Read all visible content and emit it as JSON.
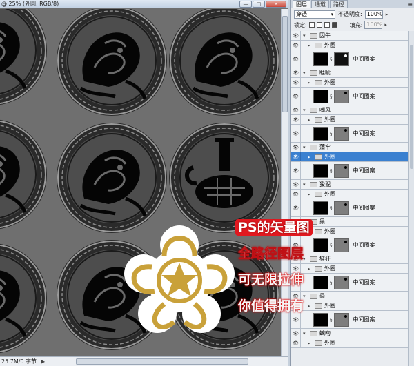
{
  "document": {
    "title": "@ 25% (外圆, RGB/8)",
    "window_buttons": [
      "—",
      "□",
      "✕"
    ],
    "status": "25.7M/0 字节",
    "status_arrow": "▶"
  },
  "layers_panel": {
    "tabs": [
      "图层",
      "通道",
      "路径"
    ],
    "active_tab": 0,
    "menu_icon": "≡",
    "blend_mode": "穿透",
    "opacity_label": "不透明度:",
    "opacity_value": "100%",
    "lock_label": "锁定:",
    "fill_label": "填充:",
    "fill_value": "100%",
    "layers": [
      {
        "kind": "group",
        "name": "囚牛",
        "indent": 0
      },
      {
        "kind": "group",
        "name": "外圈",
        "indent": 1
      },
      {
        "kind": "layer",
        "name": "中间图案",
        "mask": "dark"
      },
      {
        "kind": "group",
        "name": "睚眦",
        "indent": 0
      },
      {
        "kind": "group",
        "name": "外圈",
        "indent": 1
      },
      {
        "kind": "layer",
        "name": "中间图案",
        "mask": "gray"
      },
      {
        "kind": "group",
        "name": "嘲风",
        "indent": 0
      },
      {
        "kind": "group",
        "name": "外圈",
        "indent": 1
      },
      {
        "kind": "layer",
        "name": "中间图案",
        "mask": "gray"
      },
      {
        "kind": "group",
        "name": "蒲牢",
        "indent": 0
      },
      {
        "kind": "group",
        "name": "外圈",
        "indent": 1,
        "selected": true
      },
      {
        "kind": "layer",
        "name": "中间图案",
        "mask": "gray"
      },
      {
        "kind": "group",
        "name": "狻猊",
        "indent": 0
      },
      {
        "kind": "group",
        "name": "外圈",
        "indent": 1
      },
      {
        "kind": "layer",
        "name": "中间图案",
        "mask": "gray"
      },
      {
        "kind": "group",
        "name": "赑",
        "indent": 0
      },
      {
        "kind": "group",
        "name": "外圈",
        "indent": 1
      },
      {
        "kind": "layer",
        "name": "中间图案",
        "mask": "gray"
      },
      {
        "kind": "group",
        "name": "狴犴",
        "indent": 0
      },
      {
        "kind": "group",
        "name": "外圈",
        "indent": 1
      },
      {
        "kind": "layer",
        "name": "中间图案",
        "mask": "gray"
      },
      {
        "kind": "group",
        "name": "赑",
        "indent": 0
      },
      {
        "kind": "group",
        "name": "外圈",
        "indent": 1
      },
      {
        "kind": "layer",
        "name": "中间图案",
        "mask": "gray"
      },
      {
        "kind": "group",
        "name": "螭吻",
        "indent": 0
      },
      {
        "kind": "group",
        "name": "外圈",
        "indent": 1
      }
    ]
  },
  "promo": {
    "lines": [
      "PS的矢量图",
      "全路径图层",
      "可无限拉伸",
      "你值得拥有"
    ]
  },
  "colors": {
    "canvas_bg": "#6f6f6f",
    "selection": "#3a80d0",
    "promo_red": "#e0181f",
    "gold": "#c9a13a"
  }
}
